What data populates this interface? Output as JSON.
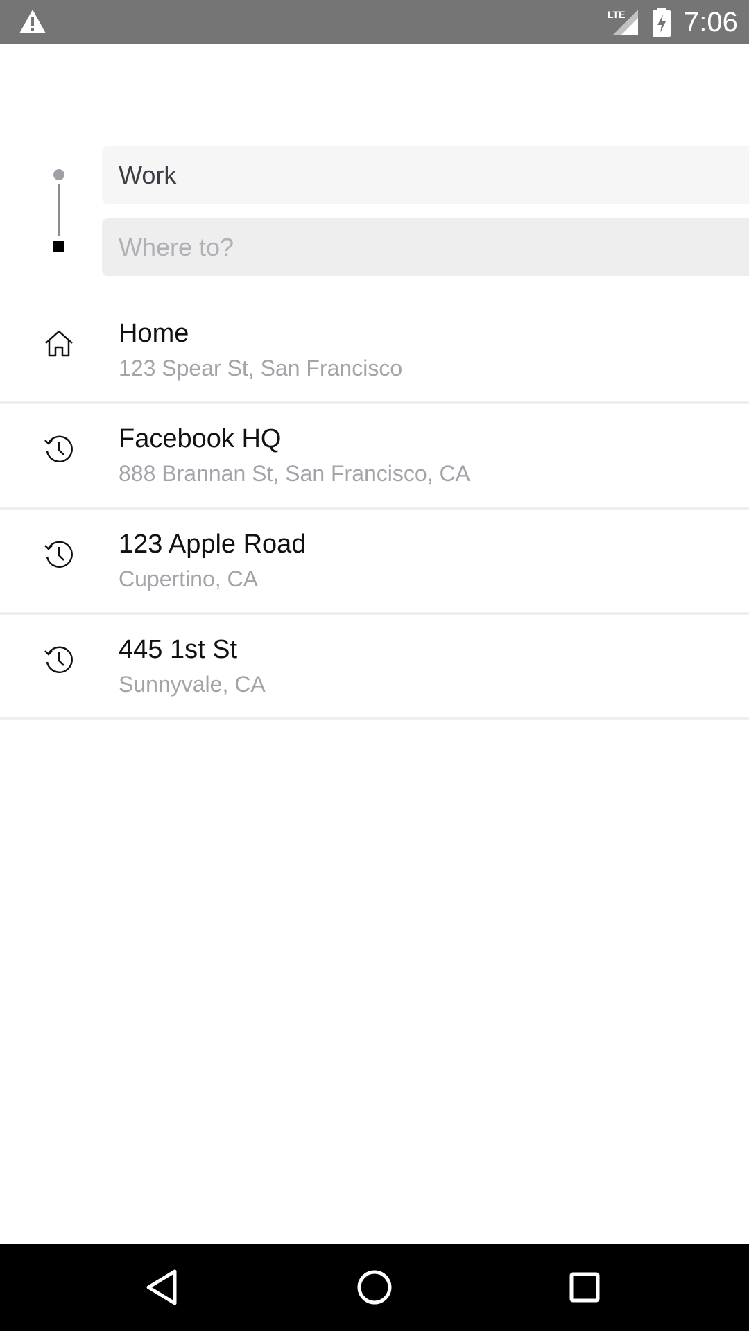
{
  "status_bar": {
    "time": "7:06",
    "network": "LTE",
    "icons": [
      "warning-icon",
      "lte-signal-icon",
      "battery-charging-icon"
    ]
  },
  "route": {
    "origin_value": "Work",
    "destination_placeholder": "Where to?"
  },
  "places": [
    {
      "icon": "home-icon",
      "title": "Home",
      "subtitle": "123 Spear St, San Francisco"
    },
    {
      "icon": "history-icon",
      "title": "Facebook HQ",
      "subtitle": "888 Brannan St, San Francisco, CA"
    },
    {
      "icon": "history-icon",
      "title": "123 Apple Road",
      "subtitle": "Cupertino, CA"
    },
    {
      "icon": "history-icon",
      "title": "445 1st St",
      "subtitle": "Sunnyvale, CA"
    }
  ],
  "nav_bar": {
    "icons": [
      "back-icon",
      "home-circle-icon",
      "recents-icon"
    ]
  },
  "colors": {
    "status_bar": "#757575",
    "field_origin": "#f6f6f7",
    "field_dest": "#eeeeef",
    "subtitle_text": "#a3a3aa",
    "divider": "#eeeeef",
    "nav_bar": "#000000"
  }
}
